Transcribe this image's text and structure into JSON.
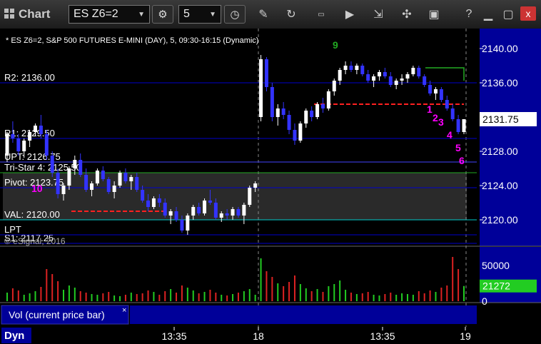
{
  "toolbar": {
    "app_title": "Chart",
    "symbol": "ES Z6=2",
    "interval": "5",
    "icons": [
      "settings-gear-icon",
      "clock-icon",
      "pencil-icon",
      "refresh-icon",
      "get-icon",
      "play-icon",
      "tools-icon",
      "monitor-icon",
      "help-icon",
      "close-icon"
    ],
    "close_label": "x"
  },
  "chart_data": {
    "type": "bar",
    "title": "* ES Z6=2, S&P 500 FUTURES E-MINI (DAY), 5, 09:30-16:15 (Dynamic)",
    "price_axis": {
      "ylim": [
        2117,
        2142
      ],
      "ticks": [
        "2140.00",
        "2136.00",
        "2132.00",
        "2128.00",
        "2124.00",
        "2120.00"
      ],
      "tick_values": [
        2140,
        2136,
        2132,
        2128,
        2124,
        2120
      ]
    },
    "x_axis": {
      "ticks": [
        "13:35",
        "18",
        "13:35",
        "19"
      ]
    },
    "last_price": {
      "label": "2131.75",
      "value": 2131.75
    },
    "levels": [
      {
        "label": "R2: 2136.00",
        "value": 2136.0,
        "color": "#0000cc"
      },
      {
        "label": "R1: 2129.50",
        "value": 2129.5,
        "color": "#0000cc"
      },
      {
        "label": "UPT: 2126.75",
        "value": 2126.75,
        "color": "#4444ff"
      },
      {
        "label": "Tri-Star 4: 2125.50",
        "value": 2125.5,
        "color": "#22aa22"
      },
      {
        "label": "Pivot: 2123.75",
        "value": 2123.75,
        "color": "#0000cc"
      },
      {
        "label": "VAL: 2120.00",
        "value": 2120.0,
        "color": "#00cccc"
      },
      {
        "label": "S1: 2117.25",
        "value": 2117.25,
        "color": "#0000cc"
      },
      {
        "label": "LPT",
        "value": 2118.25,
        "color": "#0000cc"
      }
    ],
    "watermark": "© eSignal, 2016",
    "volume": {
      "label": "Vol (current price bar)",
      "ticks": [
        "50000",
        "0"
      ],
      "tick_values": [
        50000,
        0
      ],
      "ylim": [
        0,
        72000
      ],
      "current": "21272",
      "current_value": 21272
    },
    "markers": [
      {
        "text": "10",
        "color": "#ff00ff"
      },
      {
        "text": "1",
        "color": "#ff00ff"
      },
      {
        "text": "2",
        "color": "#ff00ff"
      },
      {
        "text": "3",
        "color": "#ff00ff"
      },
      {
        "text": "4",
        "color": "#ff00ff"
      },
      {
        "text": "5",
        "color": "#ff00ff"
      },
      {
        "text": "6",
        "color": "#ff00ff"
      },
      {
        "text": "9",
        "color": "#22aa22"
      }
    ],
    "bars": [
      {
        "o": 2127.5,
        "h": 2130.25,
        "l": 2126.75,
        "c": 2130
      },
      {
        "o": 2130,
        "h": 2131.5,
        "l": 2129,
        "c": 2129.5
      },
      {
        "o": 2129.5,
        "h": 2130,
        "l": 2127.5,
        "c": 2128
      },
      {
        "o": 2128,
        "h": 2129.5,
        "l": 2127.25,
        "c": 2129.25
      },
      {
        "o": 2129.25,
        "h": 2130.5,
        "l": 2128.5,
        "c": 2130.25
      },
      {
        "o": 2130.25,
        "h": 2131.25,
        "l": 2129.75,
        "c": 2131
      },
      {
        "o": 2131,
        "h": 2132.25,
        "l": 2129.5,
        "c": 2130
      },
      {
        "o": 2130,
        "h": 2130.5,
        "l": 2127,
        "c": 2127.5
      },
      {
        "o": 2127.5,
        "h": 2128,
        "l": 2125,
        "c": 2125.5
      },
      {
        "o": 2125.5,
        "h": 2126,
        "l": 2122.5,
        "c": 2123
      },
      {
        "o": 2123,
        "h": 2124.25,
        "l": 2122.25,
        "c": 2124
      },
      {
        "o": 2124,
        "h": 2126.25,
        "l": 2123.5,
        "c": 2126
      },
      {
        "o": 2126,
        "h": 2127.5,
        "l": 2125.25,
        "c": 2127
      },
      {
        "o": 2127,
        "h": 2127.75,
        "l": 2125,
        "c": 2125.25
      },
      {
        "o": 2125.25,
        "h": 2126,
        "l": 2123.25,
        "c": 2123.5
      },
      {
        "o": 2123.5,
        "h": 2124.5,
        "l": 2122.75,
        "c": 2124.25
      },
      {
        "o": 2124.25,
        "h": 2126,
        "l": 2124,
        "c": 2125.75
      },
      {
        "o": 2125.75,
        "h": 2126.25,
        "l": 2124.5,
        "c": 2124.75
      },
      {
        "o": 2124.75,
        "h": 2125,
        "l": 2123,
        "c": 2123.25
      },
      {
        "o": 2123.25,
        "h": 2124.5,
        "l": 2122.5,
        "c": 2124
      },
      {
        "o": 2124,
        "h": 2125.75,
        "l": 2123.75,
        "c": 2125.5
      },
      {
        "o": 2125.5,
        "h": 2126,
        "l": 2124.25,
        "c": 2124.5
      },
      {
        "o": 2124.5,
        "h": 2125.25,
        "l": 2123.5,
        "c": 2125
      },
      {
        "o": 2125,
        "h": 2125.5,
        "l": 2123.25,
        "c": 2123.5
      },
      {
        "o": 2123.5,
        "h": 2124,
        "l": 2122,
        "c": 2122.25
      },
      {
        "o": 2122.25,
        "h": 2123,
        "l": 2121,
        "c": 2121.5
      },
      {
        "o": 2121.5,
        "h": 2122.75,
        "l": 2121.25,
        "c": 2122.5
      },
      {
        "o": 2122.5,
        "h": 2123,
        "l": 2121.5,
        "c": 2122
      },
      {
        "o": 2122,
        "h": 2122.5,
        "l": 2120.25,
        "c": 2120.5
      },
      {
        "o": 2120.5,
        "h": 2121.25,
        "l": 2119.5,
        "c": 2121
      },
      {
        "o": 2121,
        "h": 2121.5,
        "l": 2119.75,
        "c": 2120
      },
      {
        "o": 2120,
        "h": 2120.5,
        "l": 2118.5,
        "c": 2118.75
      },
      {
        "o": 2118.75,
        "h": 2120.75,
        "l": 2118.25,
        "c": 2120.5
      },
      {
        "o": 2120.5,
        "h": 2121.75,
        "l": 2120,
        "c": 2121.5
      },
      {
        "o": 2121.5,
        "h": 2122,
        "l": 2120.5,
        "c": 2120.75
      },
      {
        "o": 2120.75,
        "h": 2122.5,
        "l": 2120.5,
        "c": 2122.25
      },
      {
        "o": 2122.25,
        "h": 2123.5,
        "l": 2121.75,
        "c": 2122
      },
      {
        "o": 2122,
        "h": 2122.5,
        "l": 2120,
        "c": 2120.25
      },
      {
        "o": 2120.25,
        "h": 2121,
        "l": 2119.75,
        "c": 2120.75
      },
      {
        "o": 2120.75,
        "h": 2121.25,
        "l": 2120,
        "c": 2120.5
      },
      {
        "o": 2120.5,
        "h": 2121.5,
        "l": 2120,
        "c": 2121.25
      },
      {
        "o": 2121.25,
        "h": 2121.5,
        "l": 2120.25,
        "c": 2120.5
      },
      {
        "o": 2120.5,
        "h": 2122,
        "l": 2119.5,
        "c": 2121.75
      },
      {
        "o": 2121.75,
        "h": 2124,
        "l": 2121.5,
        "c": 2123.75
      },
      {
        "o": 2123.75,
        "h": 2124.5,
        "l": 2123.25,
        "c": 2124.25
      },
      {
        "o": 2132,
        "h": 2139.25,
        "l": 2131.5,
        "c": 2138.75
      },
      {
        "o": 2138.75,
        "h": 2139,
        "l": 2135,
        "c": 2135.5
      },
      {
        "o": 2135.5,
        "h": 2136,
        "l": 2131.5,
        "c": 2132
      },
      {
        "o": 2132,
        "h": 2133.5,
        "l": 2131,
        "c": 2133
      },
      {
        "o": 2133,
        "h": 2133.75,
        "l": 2131.75,
        "c": 2132.25
      },
      {
        "o": 2132.25,
        "h": 2132.75,
        "l": 2130,
        "c": 2130.5
      },
      {
        "o": 2130.5,
        "h": 2131.25,
        "l": 2128.75,
        "c": 2129.25
      },
      {
        "o": 2129.25,
        "h": 2131.5,
        "l": 2129,
        "c": 2131.25
      },
      {
        "o": 2131.25,
        "h": 2133,
        "l": 2130.75,
        "c": 2132.75
      },
      {
        "o": 2132.75,
        "h": 2133.25,
        "l": 2131.5,
        "c": 2132
      },
      {
        "o": 2132,
        "h": 2133.75,
        "l": 2131.75,
        "c": 2133.5
      },
      {
        "o": 2133.5,
        "h": 2134.25,
        "l": 2132.5,
        "c": 2133
      },
      {
        "o": 2133,
        "h": 2135.25,
        "l": 2132.75,
        "c": 2135
      },
      {
        "o": 2135,
        "h": 2136.5,
        "l": 2134.5,
        "c": 2136.25
      },
      {
        "o": 2136.25,
        "h": 2137.75,
        "l": 2135.75,
        "c": 2137.5
      },
      {
        "o": 2137.5,
        "h": 2138.5,
        "l": 2137,
        "c": 2138
      },
      {
        "o": 2138,
        "h": 2138.5,
        "l": 2137.25,
        "c": 2137.5
      },
      {
        "o": 2137.5,
        "h": 2138.25,
        "l": 2137,
        "c": 2138
      },
      {
        "o": 2138,
        "h": 2138.25,
        "l": 2136.75,
        "c": 2137
      },
      {
        "o": 2137,
        "h": 2137.5,
        "l": 2136,
        "c": 2136.25
      },
      {
        "o": 2136.25,
        "h": 2137,
        "l": 2135.5,
        "c": 2136.75
      },
      {
        "o": 2136.75,
        "h": 2137.5,
        "l": 2136.25,
        "c": 2137.25
      },
      {
        "o": 2137.25,
        "h": 2137.75,
        "l": 2136.5,
        "c": 2136.75
      },
      {
        "o": 2136.75,
        "h": 2137.25,
        "l": 2135.5,
        "c": 2135.75
      },
      {
        "o": 2135.75,
        "h": 2136.5,
        "l": 2135.25,
        "c": 2136.25
      },
      {
        "o": 2136.25,
        "h": 2137,
        "l": 2135.75,
        "c": 2136.5
      },
      {
        "o": 2136.5,
        "h": 2137.25,
        "l": 2136,
        "c": 2137
      },
      {
        "o": 2137,
        "h": 2138,
        "l": 2136.75,
        "c": 2137.75
      },
      {
        "o": 2137.75,
        "h": 2138,
        "l": 2136.5,
        "c": 2136.75
      },
      {
        "o": 2136.75,
        "h": 2137,
        "l": 2135.5,
        "c": 2135.75
      },
      {
        "o": 2135.75,
        "h": 2136.25,
        "l": 2134.5,
        "c": 2134.75
      },
      {
        "o": 2134.75,
        "h": 2135.5,
        "l": 2134,
        "c": 2135.25
      },
      {
        "o": 2135.25,
        "h": 2135.5,
        "l": 2133.75,
        "c": 2134
      },
      {
        "o": 2134,
        "h": 2134.5,
        "l": 2132.75,
        "c": 2133
      },
      {
        "o": 2133,
        "h": 2133.5,
        "l": 2131.5,
        "c": 2131.75
      },
      {
        "o": 2131.75,
        "h": 2132.25,
        "l": 2130,
        "c": 2130.25
      },
      {
        "o": 2130.25,
        "h": 2131.75,
        "l": 2130,
        "c": 2131.75
      }
    ],
    "volumes": [
      12000,
      18000,
      15000,
      9000,
      11000,
      14000,
      20000,
      45000,
      38000,
      28000,
      16000,
      22000,
      19000,
      14000,
      12000,
      10000,
      9000,
      11000,
      13000,
      8000,
      7000,
      9000,
      12000,
      10000,
      11000,
      15000,
      13000,
      9000,
      14000,
      17000,
      12000,
      22000,
      19000,
      15000,
      11000,
      13000,
      16000,
      12000,
      9000,
      8000,
      10000,
      12000,
      14000,
      17000,
      9000,
      60000,
      42000,
      34000,
      25000,
      21000,
      27000,
      36000,
      24000,
      18000,
      14000,
      17000,
      13000,
      21000,
      24000,
      29000,
      16000,
      12000,
      10000,
      11000,
      13000,
      9000,
      8000,
      10000,
      12000,
      9000,
      11000,
      10000,
      9000,
      14000,
      11000,
      15000,
      13000,
      19000,
      22000,
      62000,
      45000,
      21272
    ]
  }
}
